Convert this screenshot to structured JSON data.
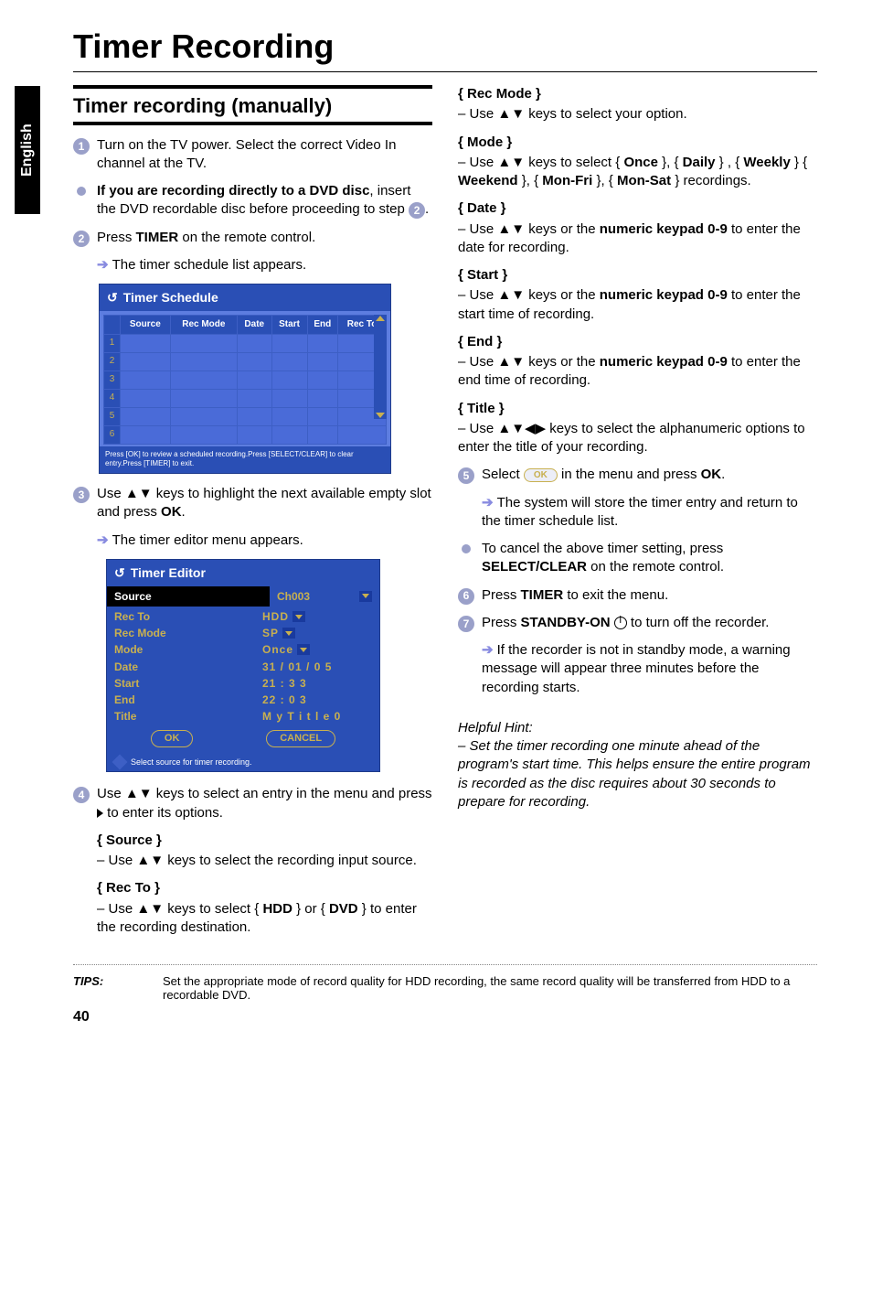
{
  "lang_tab": "English",
  "page_title": "Timer Recording",
  "section_heading": "Timer recording (manually)",
  "left": {
    "s1": "Turn on the TV power. Select the correct Video In channel at the TV.",
    "bullet_a": "If you are recording directly to a DVD disc",
    "bullet_b": ", insert the DVD recordable disc before proceeding to step ",
    "bullet_step": "2",
    "s2a": "Press ",
    "s2b": "TIMER",
    "s2c": " on the remote control.",
    "s2_res": "The timer schedule list appears.",
    "sched_title": "Timer Schedule",
    "sched_cols": [
      "",
      "Source",
      "Rec Mode",
      "Date",
      "Start",
      "End",
      "Rec To"
    ],
    "sched_rows": [
      "1",
      "2",
      "3",
      "4",
      "5",
      "6"
    ],
    "sched_foot": "Press [OK] to review a scheduled recording.Press [SELECT/CLEAR] to clear entry.Press [TIMER] to exit.",
    "s3a": "Use ▲▼ keys to highlight the next available empty slot and press ",
    "s3b": "OK",
    "s3_res": "The timer editor menu appears.",
    "editor_title": "Timer Editor",
    "editor_rows": [
      {
        "lab": "Source",
        "val": "Ch003",
        "dd": true,
        "strong": true
      },
      {
        "lab": "Rec To",
        "val": "HDD",
        "dd": true
      },
      {
        "lab": "Rec Mode",
        "val": "SP",
        "dd": true
      },
      {
        "lab": "Mode",
        "val": "Once",
        "dd": true
      },
      {
        "lab": "Date",
        "val": "31 / 01 / 0 5"
      },
      {
        "lab": "Start",
        "val": "21 : 3 3"
      },
      {
        "lab": "End",
        "val": "22 : 0 3"
      },
      {
        "lab": "Title",
        "val": "M y T i t l e 0"
      }
    ],
    "editor_ok": "OK",
    "editor_cancel": "CANCEL",
    "editor_foot": "Select source for timer recording.",
    "s4a": "Use ▲▼ keys to select an entry in the menu and press ",
    "s4b": " to enter its options.",
    "opt_source_t": "{ Source }",
    "opt_source_d": "– Use ▲▼ keys to select the recording input source.",
    "opt_recto_t": "{ Rec To }",
    "opt_recto_d1": "– Use ▲▼ keys to select { ",
    "opt_recto_hdd": "HDD",
    "opt_recto_d2": " } or { ",
    "opt_recto_dvd": "DVD",
    "opt_recto_d3": " } to enter the recording destination."
  },
  "right": {
    "recmode_t": "{ Rec Mode }",
    "recmode_d": "– Use ▲▼ keys to select your option.",
    "mode_t": "{ Mode }",
    "mode_d1": "– Use ▲▼ keys to select { ",
    "mode_once": "Once",
    "mode_d2": " }, { ",
    "mode_daily": "Daily",
    "mode_d3": " } , { ",
    "mode_weekly": "Weekly",
    "mode_d4": " } { ",
    "mode_weekend": "Weekend",
    "mode_d5": " }, { ",
    "mode_monfri": "Mon-Fri",
    "mode_d6": " }, { ",
    "mode_monsat": "Mon-Sat",
    "mode_d7": " } recordings.",
    "date_t": "{ Date }",
    "date_d1": "– Use ▲▼ keys or the ",
    "date_kp": "numeric keypad 0-9",
    "date_d2": " to enter the date for recording.",
    "start_t": "{ Start }",
    "start_d1": "– Use ▲▼ keys or the ",
    "start_d2": " to enter the start time of recording.",
    "end_t": "{ End }",
    "end_d1": "– Use ▲▼ keys or the ",
    "end_d2": " to enter the end time of recording.",
    "title_t": "{ Title }",
    "title_d": "– Use ▲▼◀▶ keys to select the alphanumeric options to enter the title of your recording.",
    "s5a": "Select ",
    "s5_ok": "OK",
    "s5b": " in the menu and press ",
    "s5c": "OK",
    "s5_res": "The system will store the timer entry and return to the timer schedule list.",
    "bullet_cancel1": "To cancel the above timer setting, press ",
    "bullet_cancel2": "SELECT/CLEAR",
    "bullet_cancel3": " on the remote control.",
    "s6a": "Press ",
    "s6b": "TIMER",
    "s6c": " to exit the menu.",
    "s7a": "Press ",
    "s7b": "STANDBY-ON",
    "s7c": " to turn off the recorder.",
    "s7_res": "If the recorder is not in standby mode, a warning message will appear three minutes before the recording starts.",
    "hint_t": "Helpful Hint:",
    "hint_d": "– Set the timer recording one minute ahead of the program's start time. This helps ensure the entire program is recorded as the disc requires about 30 seconds to prepare for recording."
  },
  "tips_label": "TIPS:",
  "tips_text": "Set the appropriate mode of record quality for HDD recording, the same record quality will be transferred from HDD to a recordable DVD.",
  "page_num": "40"
}
